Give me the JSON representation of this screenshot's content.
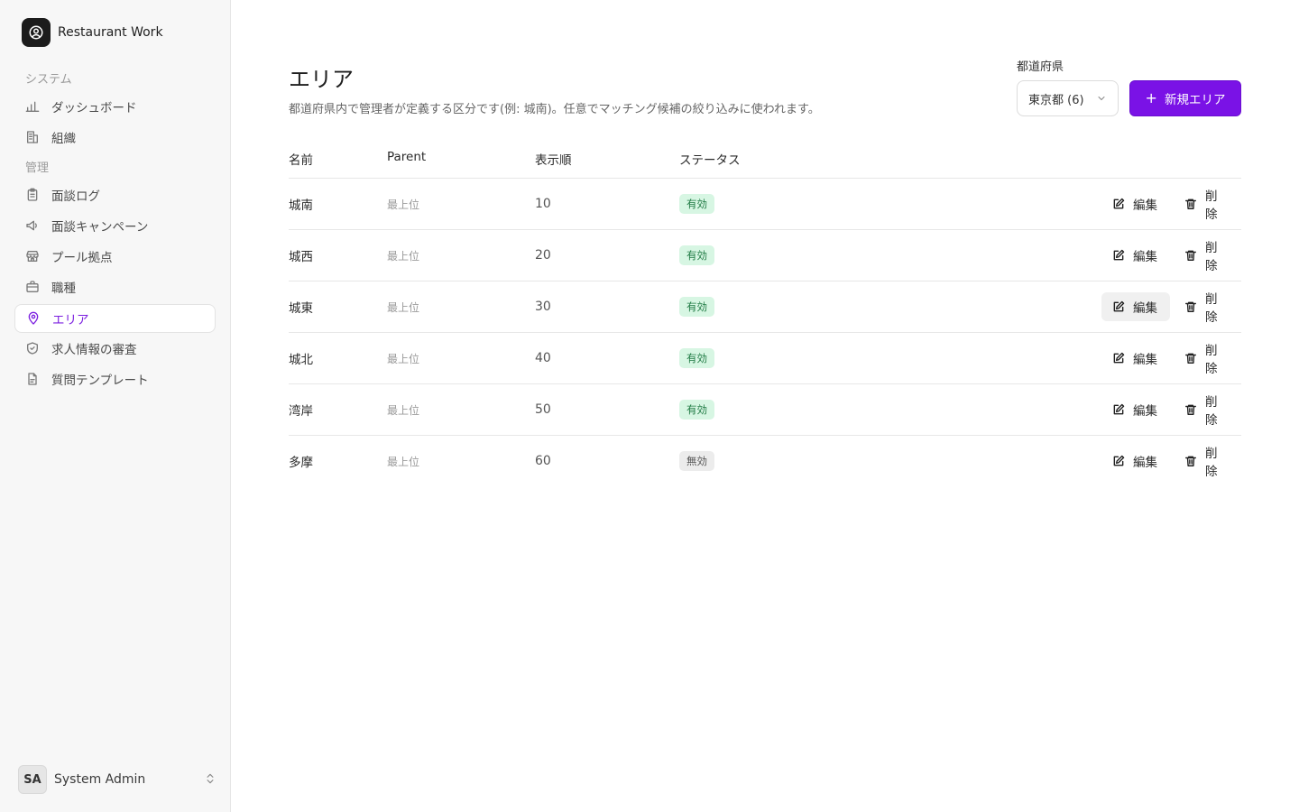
{
  "app": {
    "name": "Restaurant Work"
  },
  "sidebar": {
    "sections": [
      {
        "label": "システム"
      },
      {
        "label": "管理"
      }
    ],
    "items": [
      {
        "label": "ダッシュボード",
        "icon": "bar-chart-icon"
      },
      {
        "label": "組織",
        "icon": "building-icon"
      },
      {
        "label": "面談ログ",
        "icon": "clipboard-icon"
      },
      {
        "label": "面談キャンペーン",
        "icon": "megaphone-icon"
      },
      {
        "label": "プール拠点",
        "icon": "store-icon"
      },
      {
        "label": "職種",
        "icon": "briefcase-icon"
      },
      {
        "label": "エリア",
        "icon": "map-pin-icon",
        "active": true
      },
      {
        "label": "求人情報の審査",
        "icon": "shield-check-icon"
      },
      {
        "label": "質問テンプレート",
        "icon": "file-text-icon"
      }
    ],
    "user": {
      "initials": "SA",
      "name": "System Admin"
    }
  },
  "header": {
    "title": "エリア",
    "description": "都道府県内で管理者が定義する区分です(例: 城南)。任意でマッチング候補の絞り込みに使われます。",
    "prefecture_label": "都道府県",
    "prefecture_value": "東京都 (6)",
    "new_button": "新規エリア"
  },
  "table": {
    "columns": [
      "名前",
      "Parent",
      "表示順",
      "ステータス"
    ],
    "edit_label": "編集",
    "delete_label": "削除",
    "rows": [
      {
        "name": "城南",
        "parent": "最上位",
        "order": "10",
        "status": "有効",
        "active": true
      },
      {
        "name": "城西",
        "parent": "最上位",
        "order": "20",
        "status": "有効",
        "active": true
      },
      {
        "name": "城東",
        "parent": "最上位",
        "order": "30",
        "status": "有効",
        "active": true
      },
      {
        "name": "城北",
        "parent": "最上位",
        "order": "40",
        "status": "有効",
        "active": true
      },
      {
        "name": "湾岸",
        "parent": "最上位",
        "order": "50",
        "status": "有効",
        "active": true
      },
      {
        "name": "多摩",
        "parent": "最上位",
        "order": "60",
        "status": "無効",
        "active": false
      }
    ]
  },
  "colors": {
    "accent": "#7a12e6",
    "badge_active_bg": "#d7f6e3",
    "badge_active_text": "#1f7a43",
    "badge_inactive_bg": "#ececec"
  }
}
